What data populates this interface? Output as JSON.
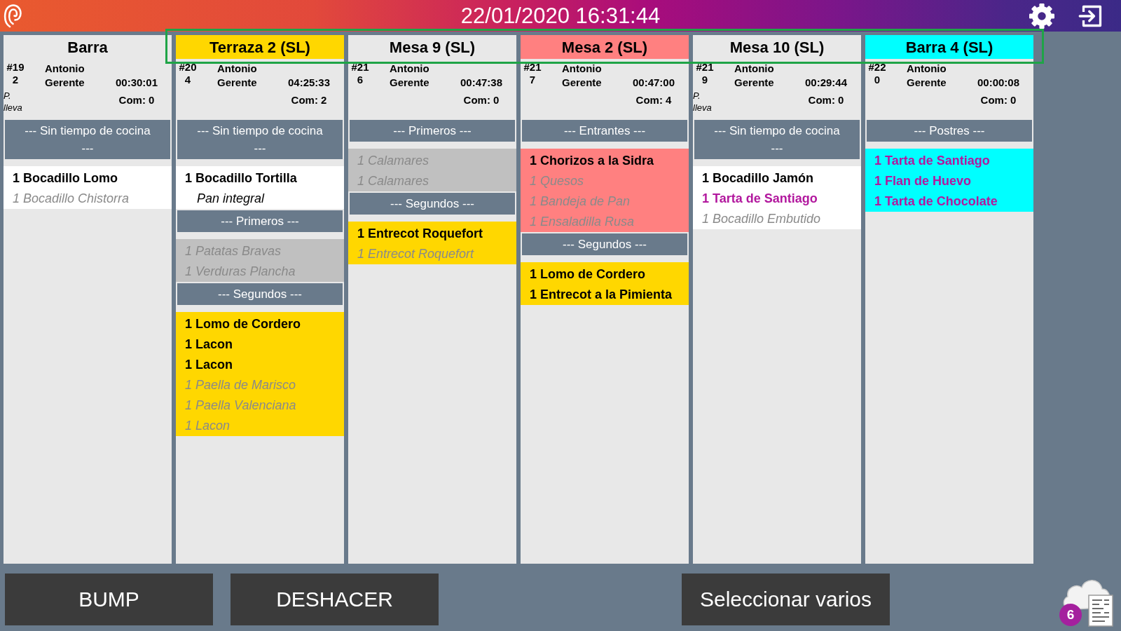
{
  "header": {
    "datetime": "22/01/2020 16:31:44"
  },
  "cards": [
    {
      "title": "Barra",
      "color": "#e8e8e8",
      "order_number": "#192",
      "waiter": "Antonio Gerente",
      "elapsed": "00:30:01",
      "comments": "Com: 0",
      "note": "P. lleva",
      "sections": [
        {
          "heading": "--- Sin tiempo de cocina ---",
          "color": "#ffffff",
          "items": [
            {
              "text": "1 Bocadillo Lomo",
              "kind": "line",
              "done": false,
              "color": "#000000"
            },
            {
              "text": "1 Bocadillo Chistorra",
              "kind": "line",
              "done": true
            }
          ]
        }
      ]
    },
    {
      "title": "Terraza 2 (SL)",
      "color": "#ffd700",
      "order_number": "#204",
      "waiter": "Antonio Gerente",
      "elapsed": "04:25:33",
      "comments": "Com: 2",
      "sections": [
        {
          "heading": "--- Sin tiempo de cocina ---",
          "color": "#ffffff",
          "items": [
            {
              "text": "1 Bocadillo Tortilla",
              "kind": "line",
              "done": false,
              "color": "#000000"
            },
            {
              "text": "Pan integral",
              "kind": "note",
              "done": false,
              "color": "#000000"
            }
          ]
        },
        {
          "heading": "--- Primeros ---",
          "color": "#c0c0c0",
          "items": [
            {
              "text": "1 Patatas Bravas",
              "kind": "line",
              "done": true
            },
            {
              "text": "1 Verduras Plancha",
              "kind": "line",
              "done": true
            }
          ]
        },
        {
          "heading": "--- Segundos ---",
          "color": "#ffd700",
          "items": [
            {
              "text": "1 Lomo de Cordero",
              "kind": "line",
              "done": false,
              "color": "#000000"
            },
            {
              "text": "1 Lacon",
              "kind": "line",
              "done": false,
              "color": "#000000"
            },
            {
              "text": "1 Lacon",
              "kind": "line",
              "done": false,
              "color": "#000000"
            },
            {
              "text": "1 Paella de Marisco",
              "kind": "line",
              "done": true
            },
            {
              "text": "1 Paella Valenciana",
              "kind": "line",
              "done": true
            },
            {
              "text": "1 Lacon",
              "kind": "line",
              "done": true
            }
          ]
        }
      ]
    },
    {
      "title": "Mesa 9 (SL)",
      "color": "#e8e8e8",
      "order_number": "#216",
      "waiter": "Antonio Gerente",
      "elapsed": "00:47:38",
      "comments": "Com: 0",
      "sections": [
        {
          "heading": "--- Primeros ---",
          "color": "#c0c0c0",
          "items": [
            {
              "text": "1 Calamares",
              "kind": "line",
              "done": true
            },
            {
              "text": "1 Calamares",
              "kind": "line",
              "done": true
            }
          ]
        },
        {
          "heading": "--- Segundos ---",
          "color": "#ffd700",
          "items": [
            {
              "text": "1 Entrecot Roquefort",
              "kind": "line",
              "done": false,
              "color": "#000000"
            },
            {
              "text": "1 Entrecot Roquefort",
              "kind": "line",
              "done": true
            }
          ]
        }
      ]
    },
    {
      "title": "Mesa 2 (SL)",
      "color": "#ff8080",
      "order_number": "#217",
      "waiter": "Antonio Gerente",
      "elapsed": "00:47:00",
      "comments": "Com: 4",
      "sections": [
        {
          "heading": "--- Entrantes ---",
          "color": "#ff8080",
          "items": [
            {
              "text": "1 Chorizos a la Sidra",
              "kind": "line",
              "done": false,
              "color": "#000000"
            },
            {
              "text": "1 Quesos",
              "kind": "line",
              "done": true
            },
            {
              "text": "1 Bandeja de Pan",
              "kind": "line",
              "done": true
            },
            {
              "text": "1 Ensaladilla Rusa",
              "kind": "line",
              "done": true
            }
          ]
        },
        {
          "heading": "--- Segundos ---",
          "color": "#ffd700",
          "items": [
            {
              "text": "1 Lomo de Cordero",
              "kind": "line",
              "done": false,
              "color": "#000000"
            },
            {
              "text": "1 Entrecot a la Pimienta",
              "kind": "line",
              "done": false,
              "color": "#000000"
            }
          ]
        }
      ]
    },
    {
      "title": "Mesa 10 (SL)",
      "color": "#e8e8e8",
      "order_number": "#219",
      "waiter": "Antonio Gerente",
      "elapsed": "00:29:44",
      "comments": "Com: 0",
      "note": "P. lleva",
      "sections": [
        {
          "heading": "--- Sin tiempo de cocina ---",
          "color": "#ffffff",
          "items": [
            {
              "text": "1 Bocadillo Jamón",
              "kind": "line",
              "done": false,
              "color": "#000000"
            },
            {
              "text": "1 Tarta de Santiago",
              "kind": "line",
              "done": false,
              "color": "#b2189e"
            },
            {
              "text": "1 Bocadillo Embutido",
              "kind": "line",
              "done": true
            }
          ]
        }
      ]
    },
    {
      "title": "Barra 4 (SL)",
      "color": "#00ffff",
      "order_number": "#220",
      "waiter": "Antonio Gerente",
      "elapsed": "00:00:08",
      "comments": "Com: 0",
      "sections": [
        {
          "heading": "--- Postres ---",
          "color": "#00ffff",
          "items": [
            {
              "text": "1 Tarta de Santiago",
              "kind": "line",
              "done": false,
              "color": "#b2189e"
            },
            {
              "text": "1 Flan de Huevo",
              "kind": "line",
              "done": false,
              "color": "#b2189e"
            },
            {
              "text": "1 Tarta de Chocolate",
              "kind": "line",
              "done": false,
              "color": "#b2189e"
            }
          ]
        }
      ]
    }
  ],
  "buttons": [
    "BUMP",
    "DESHACER",
    "Seleccionar varios"
  ],
  "pending_tickets": {
    "count": "6"
  }
}
